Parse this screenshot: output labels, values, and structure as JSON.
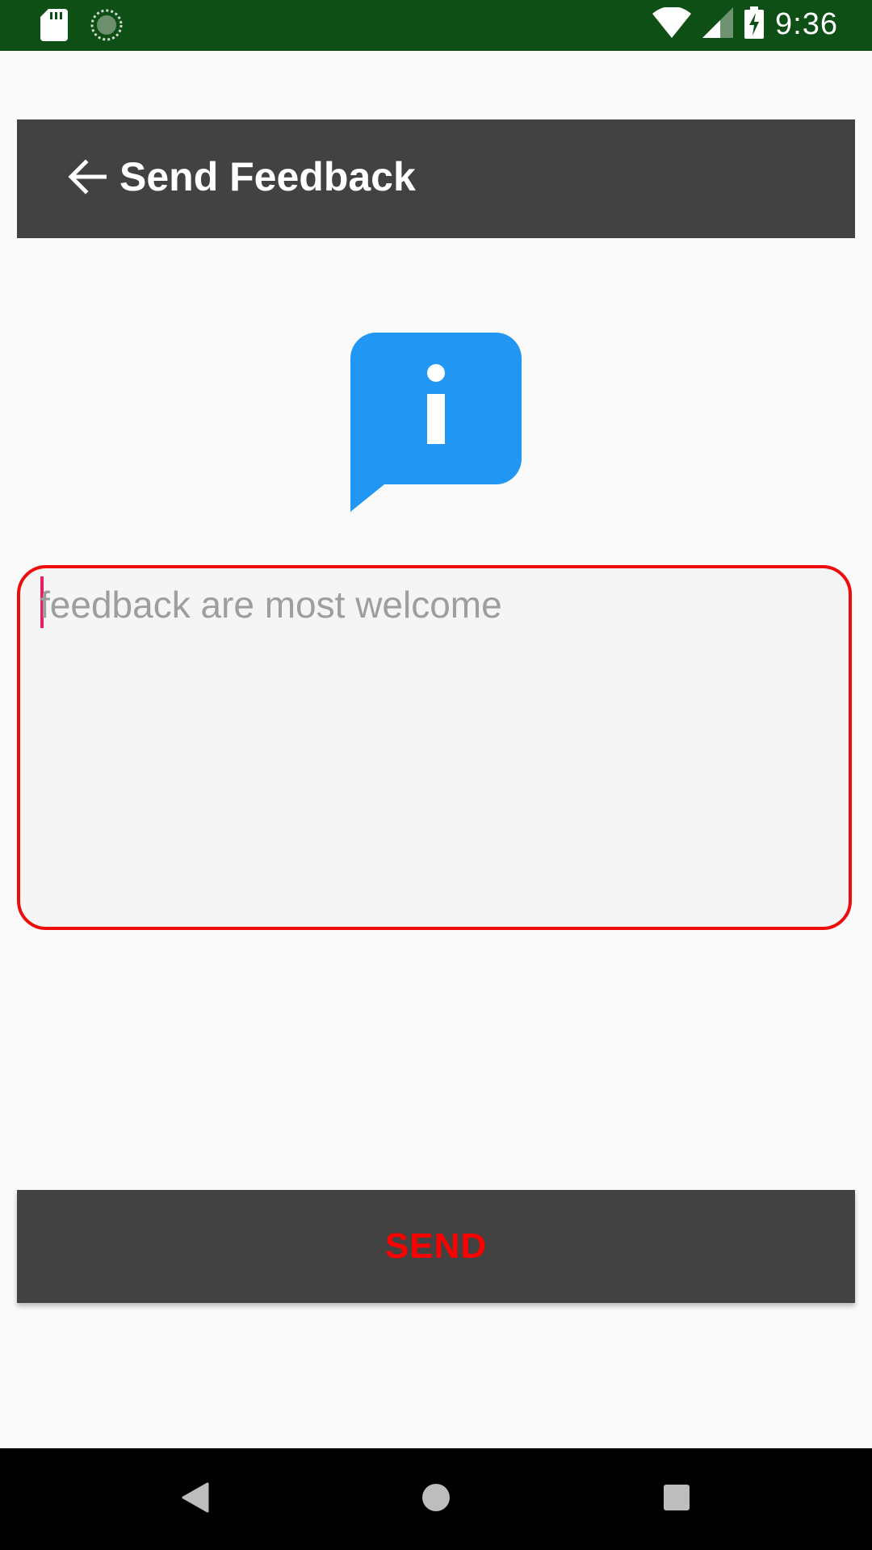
{
  "status_bar": {
    "time": "9:36",
    "icons": [
      "sd-card-icon",
      "sync-icon",
      "wifi-icon",
      "signal-icon",
      "battery-charging-icon"
    ]
  },
  "app_bar": {
    "title": "Send Feedback",
    "back_icon": "arrow-back-icon",
    "background": "#424242"
  },
  "info_icon": {
    "name": "info-chat-bubble-icon",
    "color": "#2196f3"
  },
  "feedback": {
    "placeholder": "feedback are most welcome",
    "value": "",
    "border_color": "#ee0d0d"
  },
  "send_button": {
    "label": "SEND",
    "label_color": "#ff0000"
  },
  "nav_bar": {
    "icons": [
      "nav-back-icon",
      "nav-home-icon",
      "nav-recents-icon"
    ]
  }
}
